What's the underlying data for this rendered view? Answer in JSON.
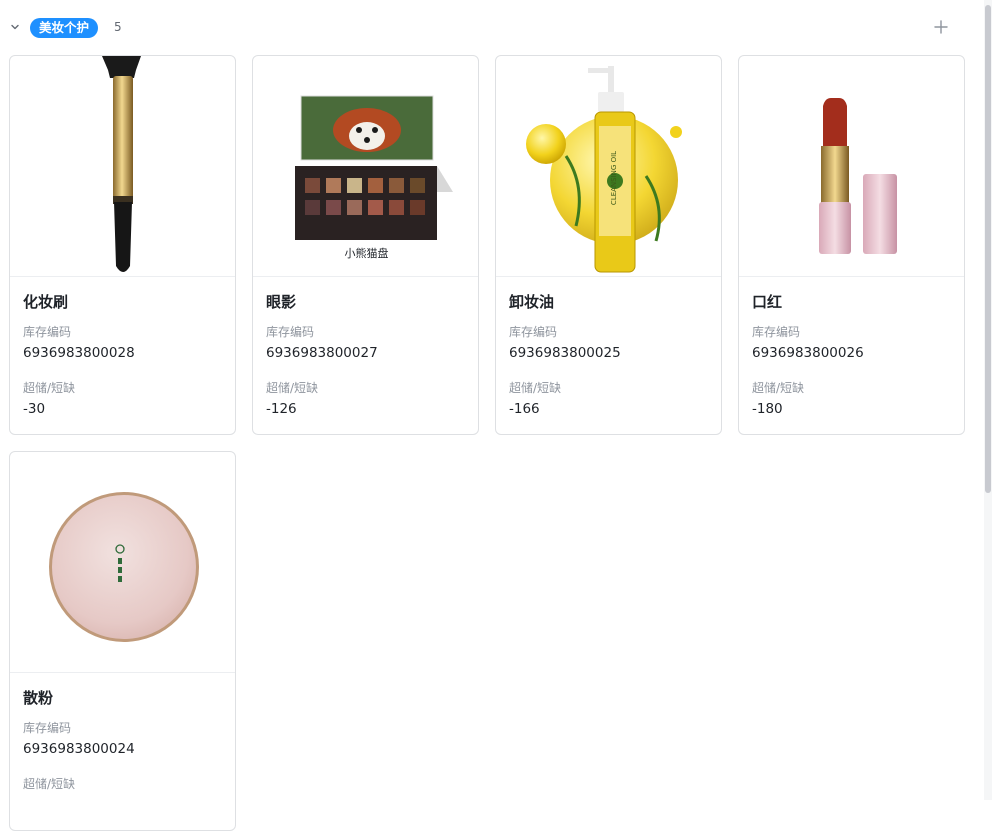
{
  "group": {
    "tag_label": "美妆个护",
    "count": "5",
    "tag_color": "#1e90ff"
  },
  "field_labels": {
    "sku": "库存编码",
    "stock": "超储/短缺"
  },
  "cards": [
    {
      "title": "化妆刷",
      "sku": "6936983800028",
      "stock": "-30",
      "image": "makeup-brush"
    },
    {
      "title": "眼影",
      "sku": "6936983800027",
      "stock": "-126",
      "image": "eyeshadow-palette",
      "image_caption": "小熊猫盘"
    },
    {
      "title": "卸妆油",
      "sku": "6936983800025",
      "stock": "-166",
      "image": "cleansing-oil",
      "image_text": "CLEANSING OIL"
    },
    {
      "title": "口红",
      "sku": "6936983800026",
      "stock": "-180",
      "image": "lipstick"
    },
    {
      "title": "散粉",
      "sku": "6936983800024",
      "stock": "",
      "image": "loose-powder"
    }
  ],
  "icons": {
    "collapse": "chevron-down-icon",
    "add": "plus-icon"
  }
}
